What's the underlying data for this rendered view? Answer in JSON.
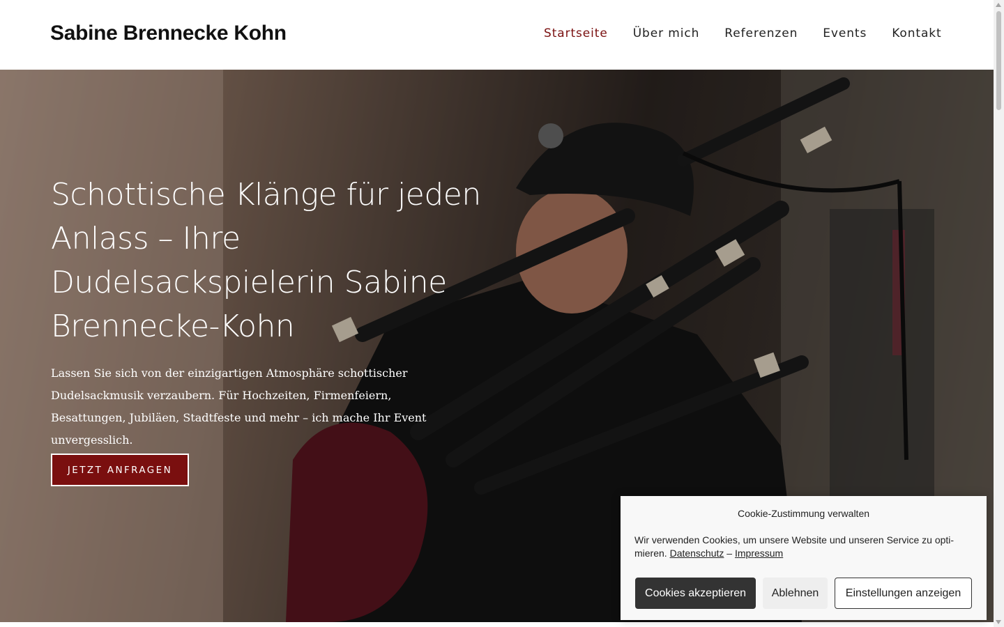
{
  "header": {
    "site_title": "Sabine Brennecke Kohn",
    "nav": [
      {
        "label": "Startseite",
        "active": true
      },
      {
        "label": "Über mich",
        "active": false
      },
      {
        "label": "Referenzen",
        "active": false
      },
      {
        "label": "Events",
        "active": false
      },
      {
        "label": "Kontakt",
        "active": false
      }
    ]
  },
  "hero": {
    "title": "Schottische Klänge für jeden Anlass – Ihre Dudelsackspielerin Sabine Brennecke-Kohn",
    "text": "Lassen Sie sich von der einzigartigen Atmosphäre schottischer Dudelsackmusik verzaubern. Für Hochzeiten, Firmenfeiern, Besattungen, Jubiläen, Stadtfeste und mehr – ich mache Ihr Event unvergesslich.",
    "cta_label": "JETZT ANFRAGEN"
  },
  "cookie": {
    "title": "Cookie-Zustimmung verwalten",
    "text_before": "Wir verwenden Cookies, um unsere Website und unseren Service zu opti-mieren. ",
    "privacy_link": "Datenschutz",
    "separator": " – ",
    "imprint_link": "Impressum",
    "accept_label": "Cookies akzeptieren",
    "deny_label": "Ablehnen",
    "settings_label": "Einstellungen anzeigen"
  },
  "colors": {
    "accent": "#7a0f0f",
    "nav_active": "#7a1010",
    "cookie_accept_bg": "#333333"
  },
  "icons": [
    "bagpipe-photo"
  ]
}
